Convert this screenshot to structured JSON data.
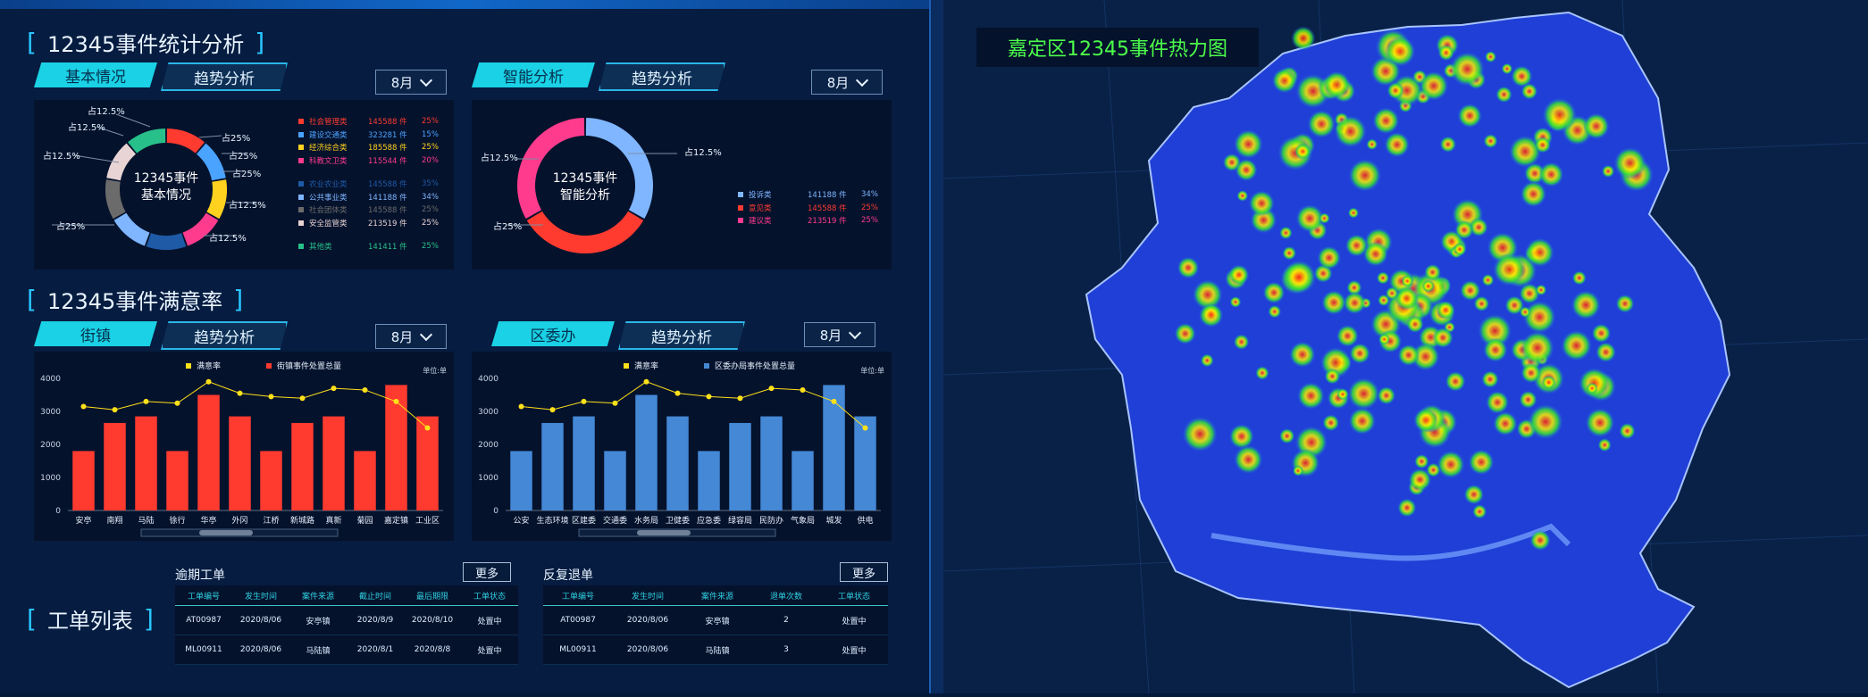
{
  "stats": {
    "title": "12345事件统计分析",
    "tab_active": "基本情况",
    "tab_inactive": "趋势分析",
    "month": "8月",
    "donut_center": "12345事件\n基本情况",
    "donut_labels": [
      "占12.5%",
      "占12.5%",
      "占12.5%",
      "占25%",
      "占25%",
      "占25%",
      "占25%",
      "占12.5%",
      "占12.5%"
    ],
    "legend": [
      {
        "name": "社会管理类",
        "value": "145588 件",
        "pct": "25%",
        "color": "#ff3b30"
      },
      {
        "name": "建设交通类",
        "value": "323281 件",
        "pct": "15%",
        "color": "#4aa3ff"
      },
      {
        "name": "经济综合类",
        "value": "185588 件",
        "pct": "25%",
        "color": "#ffd21f"
      },
      {
        "name": "科教文卫类",
        "value": "115544 件",
        "pct": "20%",
        "color": "#ff3b8d"
      },
      {
        "name": "农业农业类",
        "value": "145588 件",
        "pct": "35%",
        "color": "#1e5aa6"
      },
      {
        "name": "公共事业类",
        "value": "141188 件",
        "pct": "34%",
        "color": "#7fb6ff"
      },
      {
        "name": "社会团体类",
        "value": "145588 件",
        "pct": "25%",
        "color": "#6b6b6b"
      },
      {
        "name": "安全监管类",
        "value": "213519 件",
        "pct": "25%",
        "color": "#e8d4d4"
      },
      {
        "name": "其他类",
        "value": "141411 件",
        "pct": "25%",
        "color": "#28c08a"
      }
    ]
  },
  "smart": {
    "tab_active": "智能分析",
    "tab_inactive": "趋势分析",
    "month": "8月",
    "donut_center": "12345事件\n智能分析",
    "labels": [
      "占12.5%",
      "占12.5%",
      "占25%"
    ],
    "legend": [
      {
        "name": "投诉类",
        "value": "141188 件",
        "pct": "34%",
        "color": "#7fb6ff"
      },
      {
        "name": "意见类",
        "value": "145588 件",
        "pct": "25%",
        "color": "#ff3b30"
      },
      {
        "name": "建议类",
        "value": "213519 件",
        "pct": "25%",
        "color": "#ff3b8d"
      }
    ]
  },
  "satisfaction": {
    "title": "12345事件满意率",
    "left_tab_active": "街镇",
    "left_tab_inactive": "趋势分析",
    "right_tab_active": "区委办",
    "right_tab_inactive": "趋势分析",
    "month": "8月"
  },
  "chart_data": [
    {
      "type": "bar",
      "title": "",
      "unit": "单位:单",
      "categories": [
        "安亭",
        "南翔",
        "马陆",
        "徐行",
        "华亭",
        "外冈",
        "江桥",
        "新城路",
        "真新",
        "菊园",
        "嘉定镇",
        "工业区"
      ],
      "ylim": [
        0,
        4000
      ],
      "yticks": [
        "0",
        "1000",
        "2000",
        "3000",
        "4000"
      ],
      "series": [
        {
          "name": "街镇事件处置总量",
          "type": "bar",
          "color": "#ff3a2f",
          "values": [
            1800,
            2650,
            2850,
            1800,
            3500,
            2850,
            1800,
            2650,
            2850,
            1800,
            3800,
            2850
          ]
        },
        {
          "name": "满意率",
          "type": "line",
          "color": "#ffe11a",
          "values": [
            3150,
            3050,
            3300,
            3250,
            3900,
            3550,
            3450,
            3400,
            3700,
            3650,
            3300,
            2500
          ]
        }
      ]
    },
    {
      "type": "bar",
      "title": "",
      "unit": "单位:单",
      "categories": [
        "公安",
        "生态环境",
        "区建委",
        "交通委",
        "水务局",
        "卫健委",
        "应急委",
        "绿容局",
        "民防办",
        "气象局",
        "城发",
        "供电"
      ],
      "ylim": [
        0,
        4000
      ],
      "yticks": [
        "0",
        "1000",
        "2000",
        "3000",
        "4000"
      ],
      "series": [
        {
          "name": "区委办局事件处置总量",
          "type": "bar",
          "color": "#4488d6",
          "values": [
            1800,
            2650,
            2850,
            1800,
            3500,
            2850,
            1800,
            2650,
            2850,
            1800,
            3800,
            2850
          ]
        },
        {
          "name": "满意率",
          "type": "line",
          "color": "#ffe11a",
          "values": [
            3150,
            3050,
            3300,
            3250,
            3900,
            3550,
            3450,
            3400,
            3700,
            3650,
            3300,
            2500
          ]
        }
      ]
    }
  ],
  "orders": {
    "title": "工单列表",
    "overdue": {
      "title": "逾期工单",
      "more": "更多",
      "headers": [
        "工单编号",
        "发生时间",
        "案件来源",
        "截止时间",
        "最后期限",
        "工单状态"
      ],
      "rows": [
        [
          "AT00987",
          "2020/8/06",
          "安亭镇",
          "2020/8/9",
          "2020/8/10",
          "处置中"
        ],
        [
          "ML00911",
          "2020/8/06",
          "马陆镇",
          "2020/8/1",
          "2020/8/8",
          "处置中"
        ]
      ]
    },
    "returned": {
      "title": "反复退单",
      "more": "更多",
      "headers": [
        "工单编号",
        "发生时间",
        "案件来源",
        "退单次数",
        "工单状态"
      ],
      "rows": [
        [
          "AT00987",
          "2020/8/06",
          "安亭镇",
          "2",
          "处置中"
        ],
        [
          "ML00911",
          "2020/8/06",
          "马陆镇",
          "3",
          "处置中"
        ]
      ]
    }
  },
  "map": {
    "title": "嘉定区12345事件热力图"
  }
}
